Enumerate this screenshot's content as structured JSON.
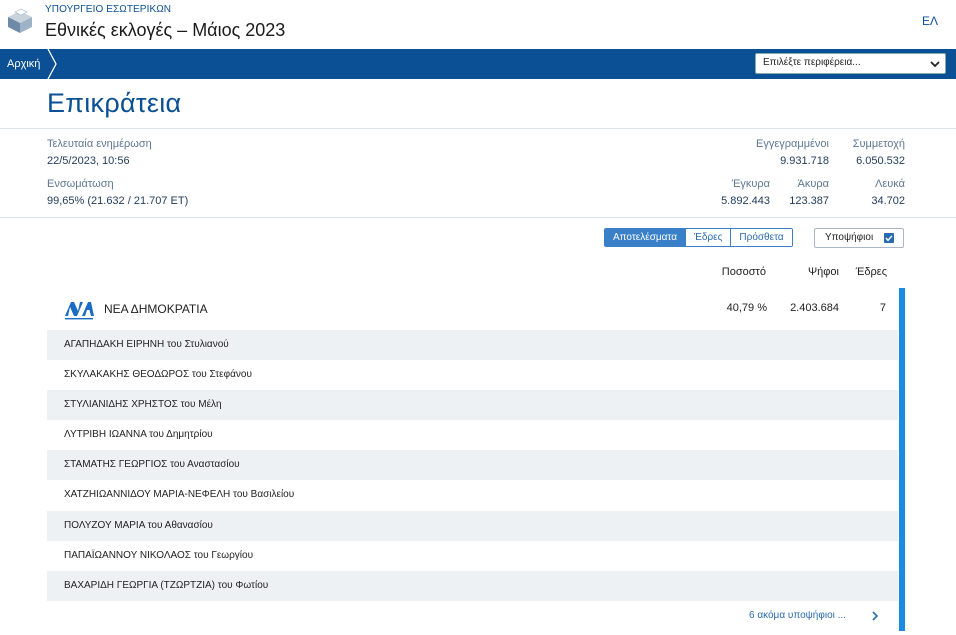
{
  "header": {
    "ministry": "ΥΠΟΥΡΓΕΙΟ ΕΣΩΤΕΡΙΚΩΝ",
    "title": "Εθνικές εκλογές – Μάιος 2023",
    "language": "ΕΛ"
  },
  "nav": {
    "home": "Αρχική",
    "region_select_placeholder": "Επιλέξτε περιφέρεια..."
  },
  "page": {
    "title": "Επικράτεια"
  },
  "stats": {
    "last_update_label": "Τελευταία ενημέρωση",
    "last_update_value": "22/5/2023, 10:56",
    "integration_label": "Ενσωμάτωση",
    "integration_value": "99,65% (21.632 / 21.707 ΕΤ)",
    "registered_label": "Εγγεγραμμένοι",
    "registered_value": "9.931.718",
    "turnout_label": "Συμμετοχή",
    "turnout_value": "6.050.532",
    "valid_label": "Έγκυρα",
    "valid_value": "5.892.443",
    "invalid_label": "Άκυρα",
    "invalid_value": "123.387",
    "blank_label": "Λευκά",
    "blank_value": "34.702"
  },
  "view_tabs": [
    "Αποτελέσματα",
    "Έδρες",
    "Πρόσθετα"
  ],
  "candidates_toggle": "Υποψήφιοι",
  "columns": {
    "percent": "Ποσοστό",
    "votes": "Ψήφοι",
    "seats": "Έδρες"
  },
  "party": {
    "name": "ΝΕΑ ΔΗΜΟΚΡΑΤΙΑ",
    "percent": "40,79 %",
    "votes": "2.403.684",
    "seats": "7",
    "color": "#1a8be0"
  },
  "candidates": [
    "ΑΓΑΠΗΔΑΚΗ ΕΙΡΗΝΗ του Στυλιανού",
    "ΣΚΥΛΑΚΑΚΗΣ ΘΕΟΔΩΡΟΣ του Στεφάνου",
    "ΣΤΥΛΙΑΝΙΔΗΣ ΧΡΗΣΤΟΣ του Μέλη",
    "ΛΥΤΡΙΒΗ ΙΩΑΝΝΑ του Δημητρίου",
    "ΣΤΑΜΑΤΗΣ ΓΕΩΡΓΙΟΣ του Αναστασίου",
    "ΧΑΤΖΗΙΩΑΝΝΙΔΟΥ ΜΑΡΙΑ-ΝΕΦΕΛΗ του Βασιλείου",
    "ΠΟΛΥΖΟΥ ΜΑΡΙΑ του Αθανασίου",
    "ΠΑΠΑΪΩΑΝΝΟΥ ΝΙΚΟΛΑΟΣ του Γεωργίου",
    "ΒΑΧΑΡΙΔΗ ΓΕΩΡΓΙΑ (ΤΖΩΡΤΖΙΑ) του Φωτίου"
  ],
  "more_candidates": "6 ακόμα υποψήφιοι ...",
  "colors": {
    "brand": "#0b4f94",
    "accent": "#3a80c8",
    "party_bar": "#1a8be0"
  }
}
